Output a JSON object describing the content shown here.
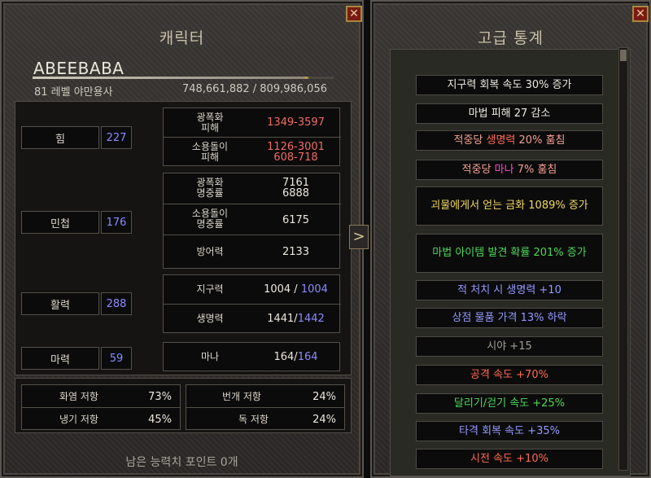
{
  "left": {
    "title": "캐릭터",
    "name": "ABEEBABA",
    "level_class": "81 레벨 야만용사",
    "xp": "748,661,882 / 809,986,056",
    "attributes": [
      {
        "name": "힘",
        "value": "227"
      },
      {
        "name": "민첩",
        "value": "176"
      },
      {
        "name": "활력",
        "value": "288"
      },
      {
        "name": "마력",
        "value": "59"
      }
    ],
    "damage1": {
      "l1": "광폭화",
      "l2": "피해",
      "value": "1349-3597"
    },
    "damage2": {
      "l1": "소용돌이",
      "l2": "피해",
      "v1": "1126-3001",
      "v2": "608-718"
    },
    "rating": {
      "l1": "광폭화",
      "l2": "명중률",
      "v1": "7161",
      "v2": "6888"
    },
    "rating2": {
      "l1": "소용돌이",
      "l2": "명중률",
      "value": "6175"
    },
    "defense": {
      "label": "방어력",
      "value": "2133"
    },
    "stamina": {
      "label": "지구력",
      "cur": "1004",
      "sep": " / ",
      "max": "1004"
    },
    "life": {
      "label": "생명력",
      "cur": "1441",
      "sep": "/",
      "max": "1442"
    },
    "mana": {
      "label": "마나",
      "cur": "164",
      "sep": "/",
      "max": "164"
    },
    "resist": [
      {
        "name": "화염 저항",
        "value": "73%"
      },
      {
        "name": "번개 저항",
        "value": "24%"
      },
      {
        "name": "냉기 저항",
        "value": "45%"
      },
      {
        "name": "독 저항",
        "value": "24%"
      }
    ],
    "remaining": "남은 능력치 포인트 0개",
    "close": "✕",
    "toggle": ">"
  },
  "right": {
    "title": "고급 통계",
    "close": "✕",
    "items": [
      {
        "parts": [
          {
            "t": "지구력 회복 속도 30% 증가",
            "c": "w"
          }
        ]
      },
      {
        "parts": [
          {
            "t": "마법 피해 27 감소",
            "c": "w"
          }
        ]
      },
      {
        "parts": [
          {
            "t": "적중당 ",
            "c": "o"
          },
          {
            "t": "생명력",
            "c": "r"
          },
          {
            "t": " 20% 훔침",
            "c": "o"
          }
        ]
      },
      {
        "parts": [
          {
            "t": "적중당 ",
            "c": "o"
          },
          {
            "t": "마나",
            "c": "m"
          },
          {
            "t": " 7% 훔침",
            "c": "o"
          }
        ]
      },
      {
        "parts": [
          {
            "t": "괴물에게서 얻는 금화 1089% 증가",
            "c": "y"
          }
        ]
      },
      {
        "parts": [
          {
            "t": "마법 아이템 발견 확률 201% 증가",
            "c": "g"
          }
        ]
      },
      {
        "parts": [
          {
            "t": "적 처치 시 생명력 +10",
            "c": "b"
          }
        ]
      },
      {
        "parts": [
          {
            "t": "상점 물품 가격 13% 하락",
            "c": "b"
          }
        ]
      },
      {
        "parts": [
          {
            "t": "시야 +15",
            "c": "gy"
          }
        ]
      },
      {
        "parts": [
          {
            "t": "공격 속도 +70%",
            "c": "r"
          }
        ]
      },
      {
        "parts": [
          {
            "t": "달리기/걷기 속도 +25%",
            "c": "g"
          }
        ]
      },
      {
        "parts": [
          {
            "t": "타격 회복 속도 +35%",
            "c": "b"
          }
        ]
      },
      {
        "parts": [
          {
            "t": "시전 속도 +10%",
            "c": "r"
          }
        ]
      }
    ]
  }
}
